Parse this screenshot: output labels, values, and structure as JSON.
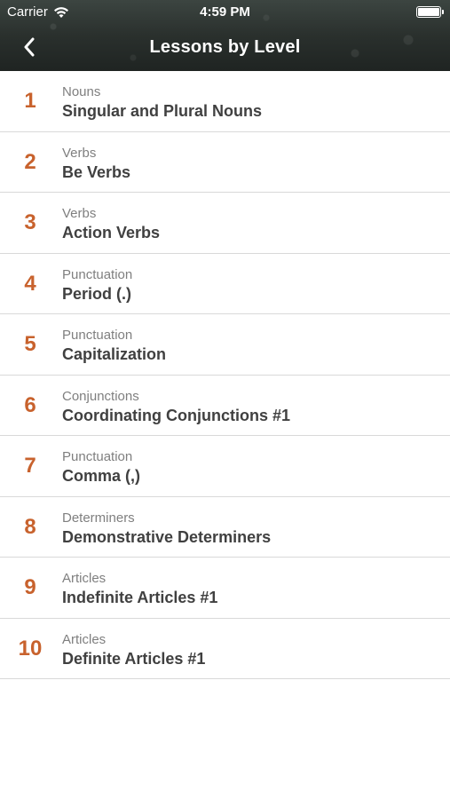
{
  "status_bar": {
    "carrier": "Carrier",
    "time": "4:59 PM"
  },
  "nav": {
    "title": "Lessons by Level",
    "back_icon": "chevron-left-icon"
  },
  "colors": {
    "accent_number": "#c8622d",
    "title_text": "#404040",
    "category_text": "#7f7f7f"
  },
  "lessons": [
    {
      "number": "1",
      "category": "Nouns",
      "title": "Singular and Plural Nouns"
    },
    {
      "number": "2",
      "category": "Verbs",
      "title": "Be Verbs"
    },
    {
      "number": "3",
      "category": "Verbs",
      "title": "Action Verbs"
    },
    {
      "number": "4",
      "category": "Punctuation",
      "title": "Period (.)"
    },
    {
      "number": "5",
      "category": "Punctuation",
      "title": "Capitalization"
    },
    {
      "number": "6",
      "category": "Conjunctions",
      "title": "Coordinating Conjunctions #1"
    },
    {
      "number": "7",
      "category": "Punctuation",
      "title": "Comma (,)"
    },
    {
      "number": "8",
      "category": "Determiners",
      "title": "Demonstrative Determiners"
    },
    {
      "number": "9",
      "category": "Articles",
      "title": "Indefinite Articles #1"
    },
    {
      "number": "10",
      "category": "Articles",
      "title": "Definite Articles #1"
    }
  ]
}
